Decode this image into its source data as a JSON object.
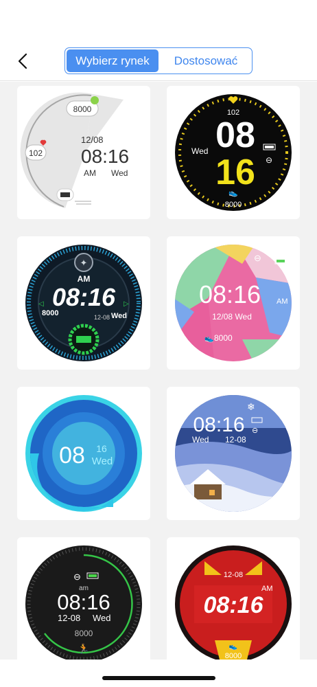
{
  "header": {
    "tabs": [
      {
        "label": "Wybierz rynek",
        "active": true
      },
      {
        "label": "Dostosować",
        "active": false
      }
    ]
  },
  "colors": {
    "accent": "#4a8ff0",
    "grid_bg": "#f2f2f2"
  },
  "watchfaces": [
    {
      "steps": "8000",
      "heart": "102",
      "date": "12/08",
      "time": "08:16",
      "ampm": "AM",
      "day": "Wed"
    },
    {
      "heart": "102",
      "hour": "08",
      "minute": "16",
      "day": "Wed",
      "steps": "8000"
    },
    {
      "ampm": "AM",
      "time": "08:16",
      "steps": "8000",
      "date": "12-08",
      "day": "Wed"
    },
    {
      "time": "08:16",
      "ampm": "AM",
      "date": "12/08 Wed",
      "steps": "8000"
    },
    {
      "hour": "08",
      "minute": "16",
      "day": "Wed"
    },
    {
      "time": "08:16",
      "day": "Wed",
      "date": "12-08"
    },
    {
      "ampm": "am",
      "time": "08:16",
      "date": "12-08",
      "day": "Wed",
      "steps": "8000"
    },
    {
      "date": "12-08",
      "ampm": "AM",
      "time": "08:16",
      "steps": "8000"
    }
  ]
}
